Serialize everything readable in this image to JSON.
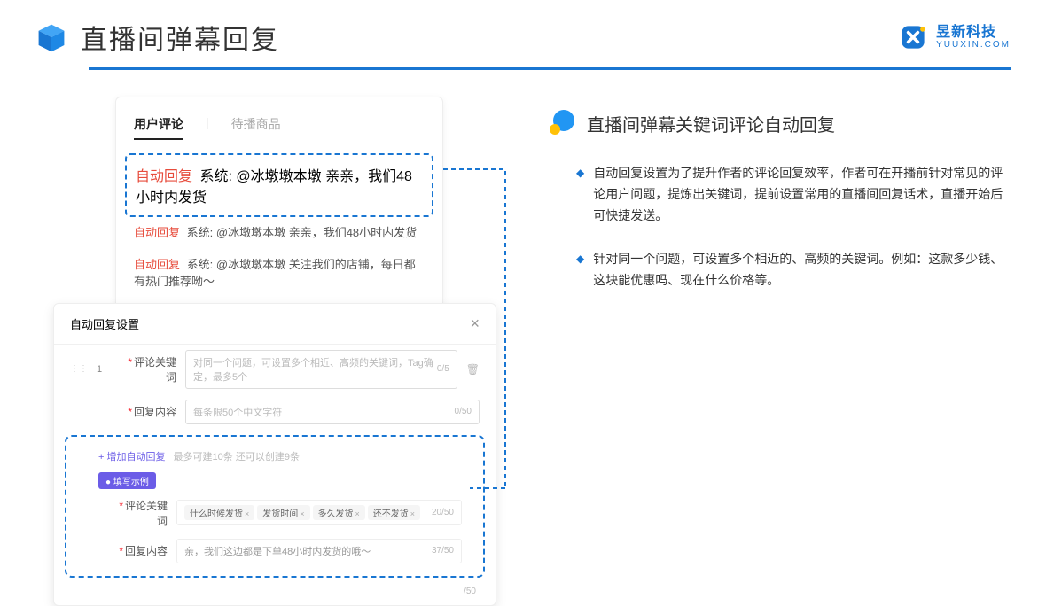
{
  "header": {
    "title": "直播间弹幕回复",
    "brand_cn": "昱新科技",
    "brand_en": "YUUXIN.COM"
  },
  "comments": {
    "tabs": {
      "active": "用户评论",
      "inactive": "待播商品"
    },
    "auto_label": "自动回复",
    "sys_label": "系统:",
    "row1": "@冰墩墩本墩 亲亲，我们48小时内发货",
    "row2": "@冰墩墩本墩 亲亲，我们48小时内发货",
    "row3": "@冰墩墩本墩 关注我们的店铺，每日都有热门推荐呦～"
  },
  "settings": {
    "title": "自动回复设置",
    "row_num": "1",
    "keyword_label": "评论关键词",
    "keyword_ph": "对同一个问题，可设置多个相近、高频的关键词，Tag确定，最多5个",
    "keyword_count": "0/5",
    "content_label": "回复内容",
    "content_ph": "每条限50个中文字符",
    "content_count": "0/50",
    "add_text": "+ 增加自动回复",
    "add_hint": "最多可建10条 还可以创建9条",
    "example_badge": "● 填写示例",
    "ex_keyword_label": "评论关键词",
    "ex_tags": [
      "什么时候发货",
      "发货时间",
      "多久发货",
      "还不发货"
    ],
    "ex_keyword_count": "20/50",
    "ex_content_label": "回复内容",
    "ex_content": "亲，我们这边都是下单48小时内发货的哦～",
    "ex_content_count": "37/50",
    "tail_count": "/50"
  },
  "right": {
    "section_title": "直播间弹幕关键词评论自动回复",
    "b1": "自动回复设置为了提升作者的评论回复效率，作者可在开播前针对常见的评论用户问题，提炼出关键词，提前设置常用的直播间回复话术，直播开始后可快捷发送。",
    "b2": "针对同一个问题，可设置多个相近的、高频的关键词。例如：这款多少钱、这块能优惠吗、现在什么价格等。"
  }
}
